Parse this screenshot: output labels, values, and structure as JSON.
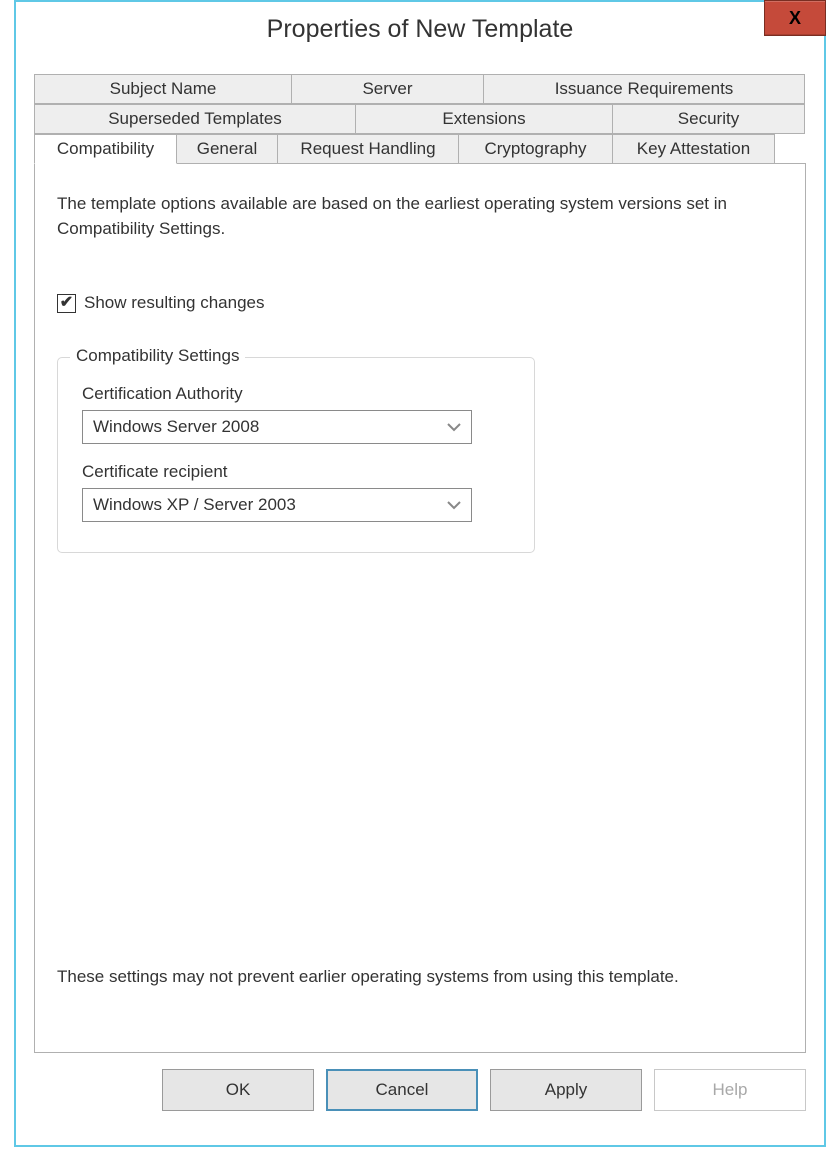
{
  "titlebar": {
    "title": "Properties of New Template",
    "close": "X"
  },
  "tabs": {
    "row1": [
      {
        "label": "Subject Name"
      },
      {
        "label": "Server"
      },
      {
        "label": "Issuance Requirements"
      }
    ],
    "row2": [
      {
        "label": "Superseded Templates"
      },
      {
        "label": "Extensions"
      },
      {
        "label": "Security"
      }
    ],
    "row3": [
      {
        "label": "Compatibility"
      },
      {
        "label": "General"
      },
      {
        "label": "Request Handling"
      },
      {
        "label": "Cryptography"
      },
      {
        "label": "Key Attestation"
      }
    ]
  },
  "panel": {
    "intro": "The template options available are based on the earliest operating system versions set in Compatibility Settings.",
    "checkbox_label": "Show resulting changes",
    "checkbox_checked": true,
    "groupbox_title": "Compatibility Settings",
    "ca_label": "Certification Authority",
    "ca_value": "Windows Server 2008",
    "recipient_label": "Certificate recipient",
    "recipient_value": "Windows XP / Server 2003",
    "footnote": "These settings may not prevent earlier operating systems from using this template."
  },
  "buttons": {
    "ok": "OK",
    "cancel": "Cancel",
    "apply": "Apply",
    "help": "Help"
  }
}
